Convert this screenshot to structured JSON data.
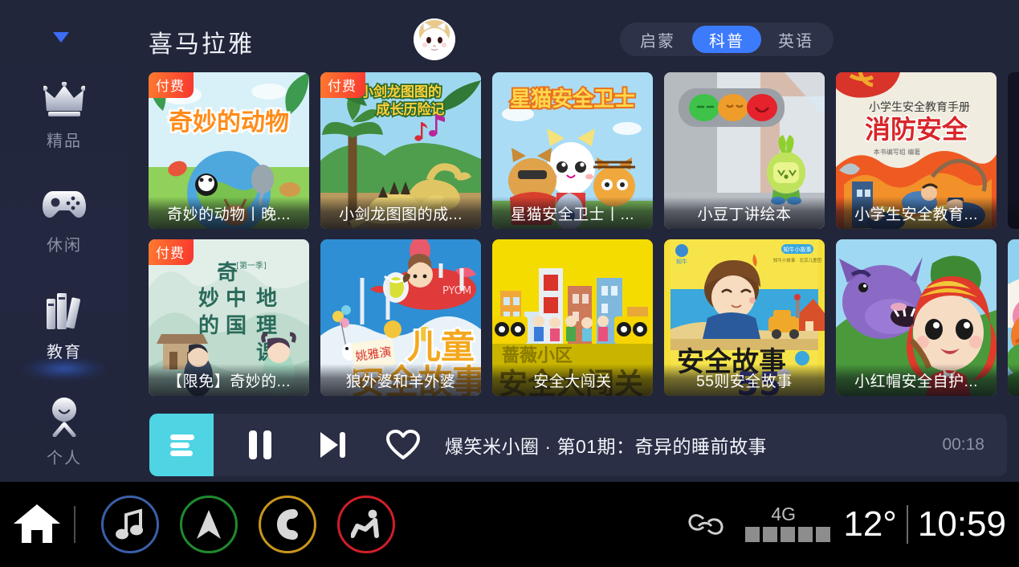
{
  "app": {
    "brand": "喜马拉雅",
    "collapse_icon": "chevron-down-icon",
    "avatar_icon": "cat-avatar"
  },
  "sidebar": {
    "items": [
      {
        "label": "精品",
        "icon": "crown-icon",
        "active": false
      },
      {
        "label": "休闲",
        "icon": "gamepad-icon",
        "active": false
      },
      {
        "label": "教育",
        "icon": "books-icon",
        "active": true
      },
      {
        "label": "个人",
        "icon": "person-icon",
        "active": false
      }
    ]
  },
  "tabs": {
    "items": [
      {
        "label": "启蒙",
        "active": false
      },
      {
        "label": "科普",
        "active": true
      },
      {
        "label": "英语",
        "active": false
      }
    ],
    "active_color": "#3d7bfd"
  },
  "grid": {
    "badge_label": "付费",
    "rows": [
      {
        "cards": [
          {
            "title": "奇妙的动物丨晚...",
            "badge": true,
            "theme": "animals"
          },
          {
            "title": "小剑龙图图的成...",
            "badge": true,
            "theme": "dinosaur"
          },
          {
            "title": "星猫安全卫士丨...",
            "badge": false,
            "theme": "starcat"
          },
          {
            "title": "小豆丁讲绘本",
            "badge": false,
            "theme": "traffic"
          },
          {
            "title": "小学生安全教育...",
            "badge": false,
            "theme": "fire"
          },
          {
            "title": "",
            "badge": false,
            "theme": "dark"
          }
        ]
      },
      {
        "cards": [
          {
            "title": "【限免】奇妙的...",
            "badge": true,
            "theme": "geography"
          },
          {
            "title": "狼外婆和羊外婆",
            "badge": false,
            "theme": "plane"
          },
          {
            "title": "安全大闯关",
            "badge": false,
            "theme": "city"
          },
          {
            "title": "55则安全故事",
            "badge": false,
            "theme": "safety"
          },
          {
            "title": "小红帽安全自护...",
            "badge": false,
            "theme": "redhood"
          },
          {
            "title": "",
            "badge": false,
            "theme": "flower"
          }
        ]
      }
    ]
  },
  "player": {
    "playlist_icon": "playlist-icon",
    "pause_icon": "pause-icon",
    "next_icon": "next-track-icon",
    "favorite_icon": "heart-icon",
    "title": "爆笑米小圈 · 第01期：奇异的睡前故事",
    "elapsed": "00:18",
    "accent_color": "#4fd4e4"
  },
  "systembar": {
    "home_icon": "home-icon",
    "shortcuts": [
      {
        "icon": "music-note-icon",
        "color": "#3a5fa8"
      },
      {
        "icon": "navigation-icon",
        "color": "#1f8a2e"
      },
      {
        "icon": "phone-icon",
        "color": "#c9961c"
      },
      {
        "icon": "seat-icon",
        "color": "#d01f2a"
      }
    ],
    "link_icon": "link-icon",
    "network": "4G",
    "signal_bars": 5,
    "temperature": "12°",
    "time": "10:59"
  }
}
